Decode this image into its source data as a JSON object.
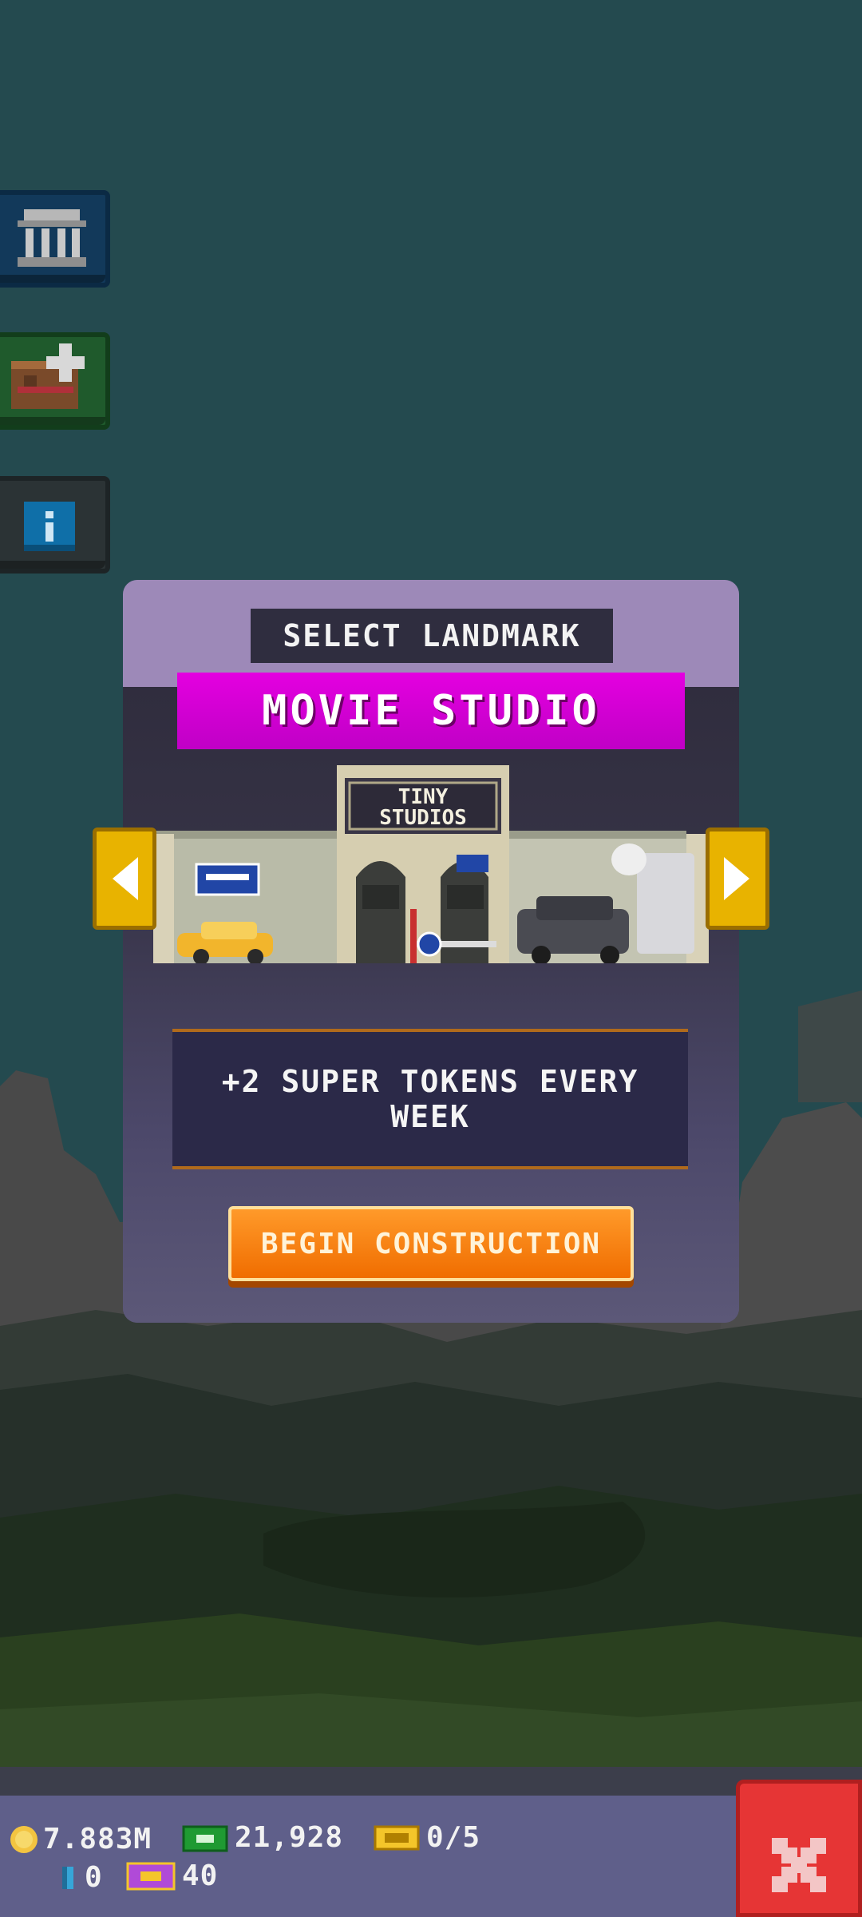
{
  "sidebar": {
    "buttons": [
      {
        "name": "museum-button",
        "icon": "museum-icon"
      },
      {
        "name": "add-floor-button",
        "icon": "add-floor-icon"
      },
      {
        "name": "info-button",
        "icon": "info-icon"
      }
    ]
  },
  "modal": {
    "header": "SELECT LANDMARK",
    "landmark_title": "MOVIE STUDIO",
    "sign_line1": "TINY",
    "sign_line2": "STUDIOS",
    "description": "+2 SUPER TOKENS EVERY WEEK",
    "begin_button": "BEGIN CONSTRUCTION",
    "prev_icon": "arrow-left-icon",
    "next_icon": "arrow-right-icon"
  },
  "resources": {
    "coins": "7.883M",
    "bux": "21,928",
    "golden_tickets": "0/5",
    "keys": "0",
    "super_tokens": "40"
  },
  "colors": {
    "panel_header": "#9d89b8",
    "title_bar": "#d800d8",
    "begin_button": "#f58012",
    "close_button": "#e63535",
    "arrows": "#e8b300"
  },
  "close_icon": "close-x-icon"
}
